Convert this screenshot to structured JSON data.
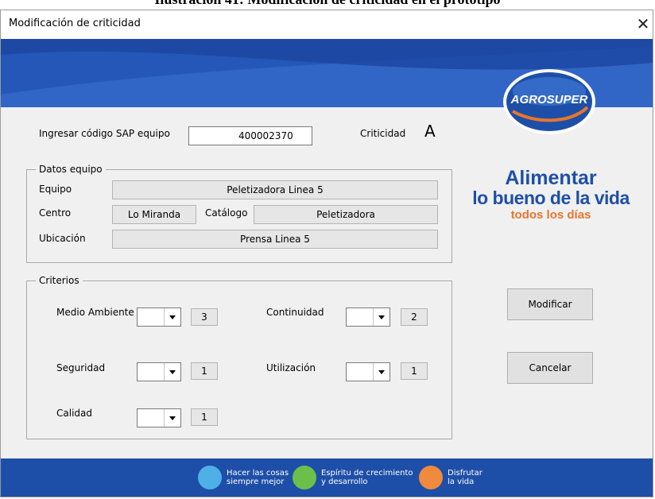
{
  "caption": "Ilustración 41: Modificación de criticidad en el prototipo",
  "window": {
    "title": "Modificación de criticidad",
    "close_glyph": "✕"
  },
  "brand": {
    "logo": "AGROSUPER",
    "slogan_line1": "Alimentar",
    "slogan_line2": "lo bueno de la vida",
    "slogan_line3": "todos los días",
    "blue": "#1e4fa8",
    "orange": "#e8762c"
  },
  "sap": {
    "label": "Ingresar código SAP equipo",
    "value": "400002370",
    "criticidad_label": "Criticidad",
    "criticidad_value": "A"
  },
  "datos": {
    "legend": "Datos equipo",
    "equipo_label": "Equipo",
    "equipo_value": "Peletizadora Linea 5",
    "centro_label": "Centro",
    "centro_value": "Lo Miranda",
    "catalogo_label": "Catálogo",
    "catalogo_value": "Peletizadora",
    "ubicacion_label": "Ubicación",
    "ubicacion_value": "Prensa Linea 5"
  },
  "criterios": {
    "legend": "Criterios",
    "medio_ambiente": {
      "label": "Medio Ambiente",
      "value": "3"
    },
    "continuidad": {
      "label": "Continuidad",
      "value": "2"
    },
    "seguridad": {
      "label": "Seguridad",
      "value": "1"
    },
    "utilizacion": {
      "label": "Utilización",
      "value": "1"
    },
    "calidad": {
      "label": "Calidad",
      "value": "1"
    }
  },
  "buttons": {
    "modificar": "Modificar",
    "cancelar": "Cancelar"
  },
  "footer": {
    "items": [
      {
        "line1": "Hacer las cosas",
        "line2": "siempre mejor"
      },
      {
        "line1": "Espíritu de crecimiento",
        "line2": "y desarrollo"
      },
      {
        "line1": "Disfrutar",
        "line2": "la vida"
      }
    ]
  }
}
